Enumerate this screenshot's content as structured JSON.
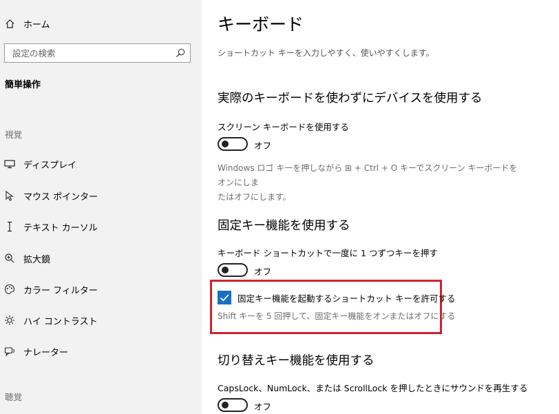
{
  "sidebar": {
    "home_label": "ホーム",
    "search_placeholder": "設定の検索",
    "category_title": "簡単操作",
    "section_vision": "視覚",
    "section_hearing": "聴覚",
    "items": [
      {
        "label": "ディスプレイ",
        "icon": "monitor-icon"
      },
      {
        "label": "マウス ポインター",
        "icon": "mouse-pointer-icon"
      },
      {
        "label": "テキスト カーソル",
        "icon": "text-cursor-icon"
      },
      {
        "label": "拡大鏡",
        "icon": "magnifier-icon"
      },
      {
        "label": "カラー フィルター",
        "icon": "palette-icon"
      },
      {
        "label": "ハイ コントラスト",
        "icon": "high-contrast-icon"
      },
      {
        "label": "ナレーター",
        "icon": "narrator-icon"
      }
    ]
  },
  "main": {
    "title": "キーボード",
    "subtitle": "ショートカット キーを入力しやすく、使いやすくします。",
    "onscreen": {
      "heading": "実際のキーボードを使わずにデバイスを使用する",
      "setting_label": "スクリーン キーボードを使用する",
      "state": "オフ",
      "desc_line1": "Windows ロゴ キーを押しながら ⊞ + Ctrl + O キーでスクリーン キーボードをオンにしま",
      "desc_line2": "たはオフにします。"
    },
    "sticky": {
      "heading": "固定キー機能を使用する",
      "setting_label": "キーボード ショートカットで一度に 1 つずつキーを押す",
      "state": "オフ",
      "checkbox_label": "固定キー機能を起動するショートカット キーを許可する",
      "checkbox_checked": true,
      "checkbox_desc": "Shift キーを 5 回押して、固定キー機能をオンまたはオフにする"
    },
    "toggle_keys": {
      "heading": "切り替えキー機能を使用する",
      "setting_label": "CapsLock、NumLock、または ScrollLock を押したときにサウンドを再生する",
      "state": "オフ"
    }
  },
  "colors": {
    "sidebar_bg": "#f2f2f2",
    "accent": "#1a6fc4",
    "highlight": "#d1212f"
  }
}
